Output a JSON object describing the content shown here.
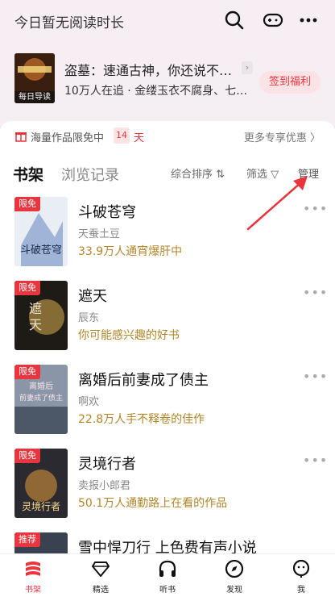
{
  "header": {
    "reading_time": "今日暂无阅读时长",
    "icons": [
      "search-icon",
      "gamepad-icon",
      "more-icon"
    ]
  },
  "recommendation": {
    "cover_tag": "每日导读",
    "title": "盗墓：速通古神，你还说不…",
    "subtitle": "10万人在追 · 金缕玉衣不腐身、七…",
    "signin_label": "签到福利"
  },
  "promo": {
    "text": "海量作品限免中",
    "days": "14",
    "days_label": "天",
    "more": "更多专享优惠 〉"
  },
  "tabs": {
    "shelf": "书架",
    "history": "浏览记录",
    "sort": "综合排序 ⇅",
    "filter": "筛选 ▽",
    "manage": "管理"
  },
  "books": [
    {
      "tag": "限免",
      "title": "斗破苍穹",
      "author": "天蚕土豆",
      "info": "33.9万人通宵爆肝中"
    },
    {
      "tag": "限免",
      "title": "遮天",
      "author": "辰东",
      "info": "你可能感兴趣的好书"
    },
    {
      "tag": "限免",
      "title": "离婚后前妻成了债主",
      "author": "啊欢",
      "info": "22.8万人手不释卷的佳作"
    },
    {
      "tag": "限免",
      "title": "灵境行者",
      "author": "卖报小郎君",
      "info": "50.1万人通勤路上在看的作品"
    },
    {
      "tag": "推荐",
      "title": "雪中悍刀行 上色费有声小说",
      "author": "",
      "info": ""
    }
  ],
  "book_more": "•••",
  "bottom_nav": [
    {
      "label": "书架",
      "icon": "bookshelf-icon",
      "active": true
    },
    {
      "label": "精选",
      "icon": "diamond-icon",
      "active": false
    },
    {
      "label": "听书",
      "icon": "headphones-icon",
      "active": false
    },
    {
      "label": "发现",
      "icon": "compass-icon",
      "active": false
    },
    {
      "label": "我",
      "icon": "profile-icon",
      "active": false
    }
  ],
  "colors": {
    "accent": "#e8353e",
    "gold": "#b1862a"
  }
}
